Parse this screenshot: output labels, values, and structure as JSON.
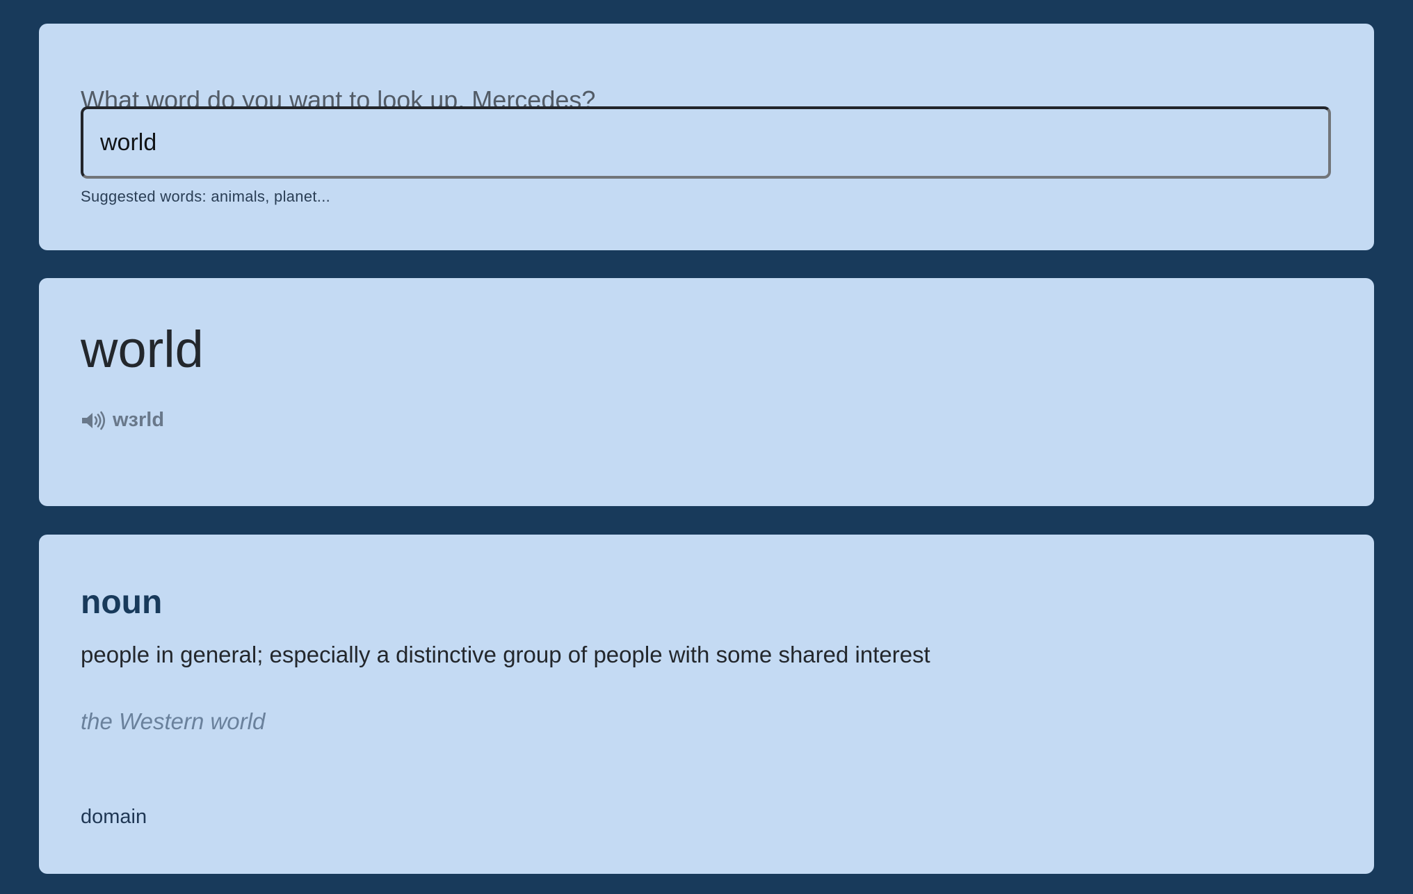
{
  "search": {
    "prompt": "What word do you want to look up, Mercedes?",
    "value": "world",
    "suggestions": "Suggested words: animals, planet..."
  },
  "entry": {
    "word": "world",
    "phonetic": "wɜrld",
    "speaker_icon": "speaker-volume-icon"
  },
  "meaning": {
    "part_of_speech": "noun",
    "definition": "people in general; especially a distinctive group of people with some shared interest",
    "example": "the Western world",
    "domain": "domain"
  },
  "colors": {
    "page_background": "#183a5b",
    "card_background": "#c4daf3",
    "accent": "#183a5b"
  }
}
